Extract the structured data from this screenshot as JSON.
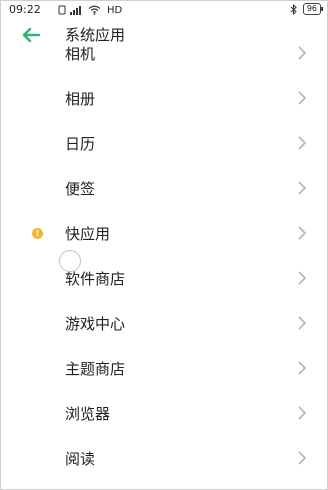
{
  "status_bar": {
    "time": "09:22",
    "network_label": "HD",
    "battery_level": "96",
    "icons": [
      "notification-icon",
      "signal-icon",
      "wifi-icon",
      "bluetooth-icon",
      "battery-icon"
    ]
  },
  "header": {
    "title": "系统应用",
    "back_icon": "back-arrow-icon"
  },
  "list": {
    "items": [
      {
        "label": "相机",
        "badge": false
      },
      {
        "label": "相册",
        "badge": false
      },
      {
        "label": "日历",
        "badge": false
      },
      {
        "label": "便签",
        "badge": false
      },
      {
        "label": "快应用",
        "badge": true
      },
      {
        "label": "软件商店",
        "badge": false
      },
      {
        "label": "游戏中心",
        "badge": false
      },
      {
        "label": "主题商店",
        "badge": false
      },
      {
        "label": "浏览器",
        "badge": false
      },
      {
        "label": "阅读",
        "badge": false
      }
    ]
  },
  "colors": {
    "accent": "#2bb673",
    "badge": "#f2b632",
    "chevron": "#b5b5b5",
    "text": "#222222"
  }
}
